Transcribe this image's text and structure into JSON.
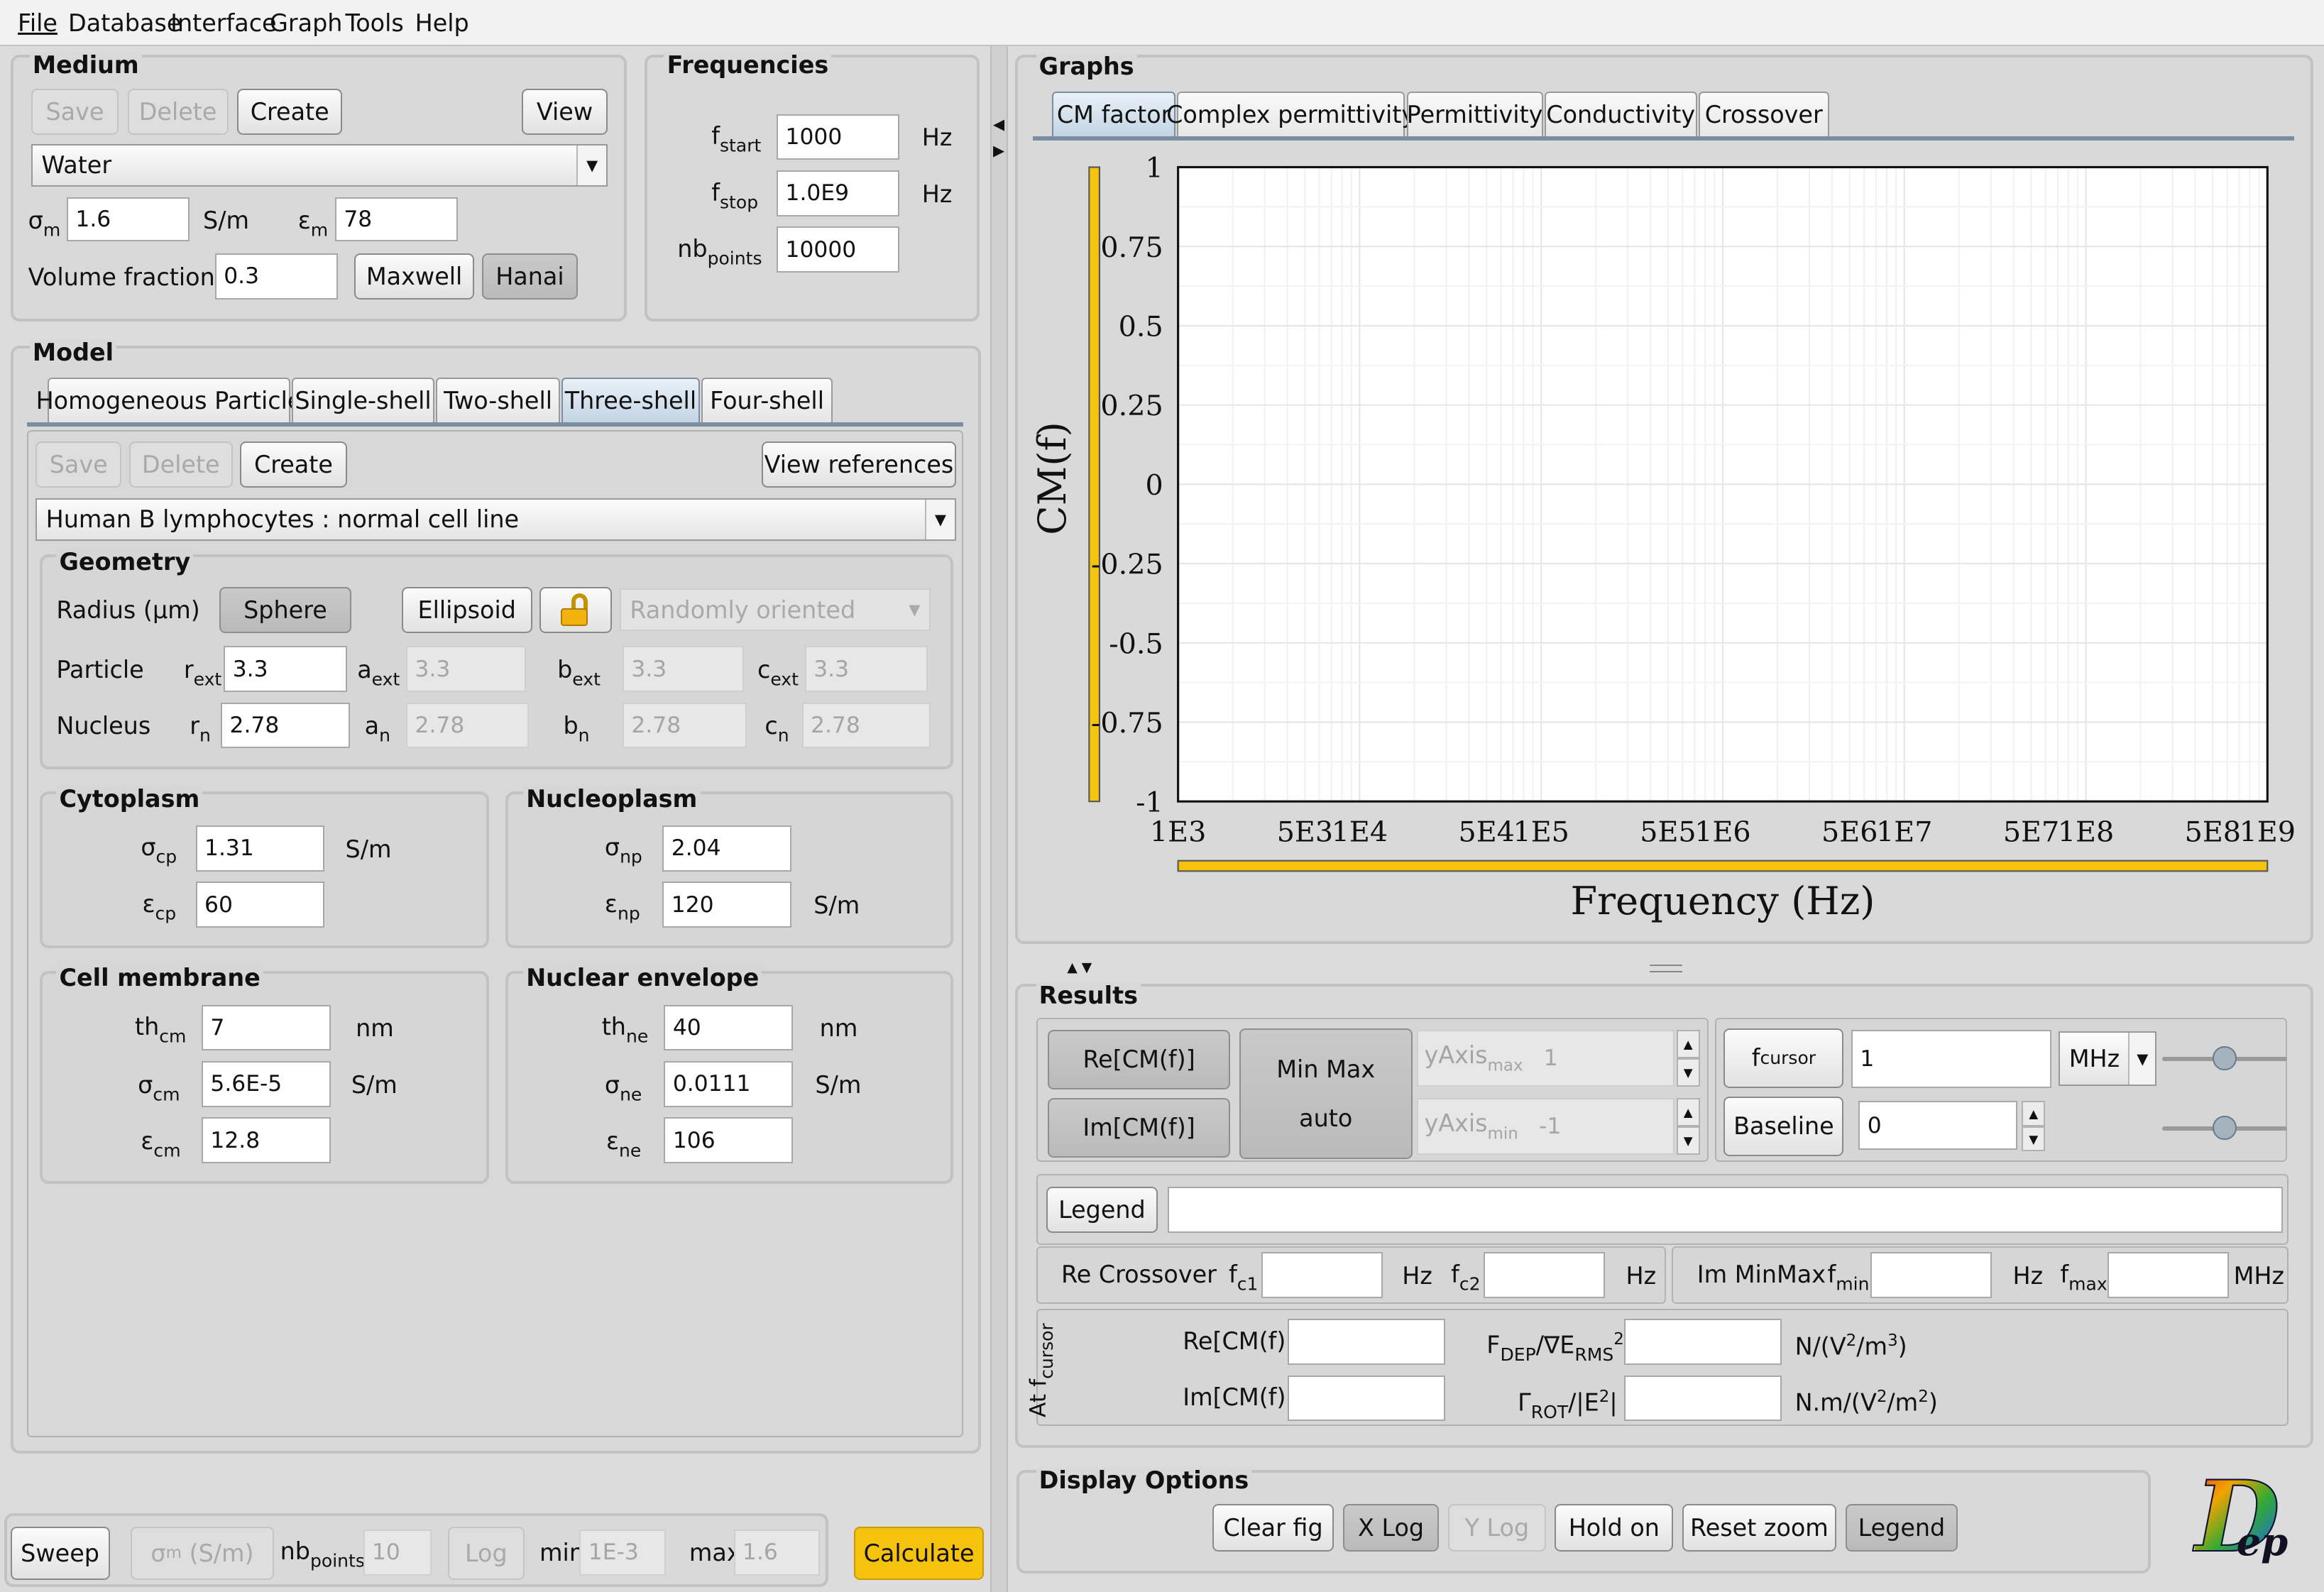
{
  "menu": [
    "File",
    "Database",
    "Interface",
    "Graph",
    "Tools",
    "Help"
  ],
  "medium": {
    "title": "Medium",
    "save": "Save",
    "delete": "Delete",
    "create": "Create",
    "view": "View",
    "selected": "Water",
    "sigma_label": "σ",
    "sigma_sub": "m",
    "sigma_value": "1.6",
    "sigma_unit": "S/m",
    "eps_label": "ε",
    "eps_sub": "m",
    "eps_value": "78",
    "vf_label": "Volume fraction Φ",
    "vf_value": "0.3",
    "maxwell": "Maxwell",
    "hanai": "Hanai"
  },
  "frequencies": {
    "title": "Frequencies",
    "fstart_sub": "start",
    "fstart_value": "1000",
    "fstop_sub": "stop",
    "fstop_value": "1.0E9",
    "nb_sub": "points",
    "nb_value": "10000",
    "unit": "Hz",
    "f": "f",
    "nb": "nb"
  },
  "model": {
    "title": "Model",
    "tabs": [
      "Homogeneous Particle",
      "Single-shell",
      "Two-shell",
      "Three-shell",
      "Four-shell"
    ],
    "save": "Save",
    "delete": "Delete",
    "create": "Create",
    "view_refs": "View references",
    "selected": "Human B lymphocytes : normal cell line",
    "geometry": {
      "title": "Geometry",
      "radius_label": "Radius (µm)",
      "sphere": "Sphere",
      "ellipsoid": "Ellipsoid",
      "orientation": "Randomly oriented",
      "particle": "Particle",
      "nucleus": "Nucleus",
      "r_ext": "3.3",
      "a_ext": "3.3",
      "b_ext": "3.3",
      "c_ext": "3.3",
      "r_n": "2.78",
      "a_n": "2.78",
      "b_n": "2.78",
      "c_n": "2.78",
      "sub_ext": "ext",
      "sub_n": "n"
    },
    "cytoplasm": {
      "title": "Cytoplasm",
      "sigma": "1.31",
      "sigma_unit": "S/m",
      "eps": "60",
      "sub": "cp"
    },
    "nucleoplasm": {
      "title": "Nucleoplasm",
      "sigma": "2.04",
      "eps": "120",
      "eps_unit": "S/m",
      "sub": "np"
    },
    "membrane": {
      "title": "Cell membrane",
      "th": "7",
      "th_unit": "nm",
      "sigma": "5.6E-5",
      "sigma_unit": "S/m",
      "eps": "12.8",
      "sub": "cm"
    },
    "envelope": {
      "title": "Nuclear envelope",
      "th": "40",
      "th_unit": "nm",
      "sigma": "0.0111",
      "sigma_unit": "S/m",
      "eps": "106",
      "sub": "ne"
    }
  },
  "sweep": {
    "sweep": "Sweep",
    "sigma": "σ",
    "sigma_sub": "m",
    "sigma_unit": "(S/m)",
    "nb": "nb",
    "nb_sub": "points",
    "nb_value": "10",
    "log": "Log",
    "min_label": "min",
    "min_value": "1E-3",
    "max_label": "max",
    "max_value": "1.6",
    "calculate": "Calculate"
  },
  "graphs": {
    "title": "Graphs",
    "tabs": [
      "CM factor",
      "Complex permittivity",
      "Permittivity",
      "Conductivity",
      "Crossover"
    ]
  },
  "chart_data": {
    "type": "line",
    "title": "",
    "xlabel": "Frequency (Hz)",
    "ylabel": "CM(f)",
    "xscale": "log",
    "xlim": [
      1000,
      1000000000
    ],
    "ylim": [
      -1,
      1
    ],
    "yticks": [
      "1",
      "0.75",
      "0.5",
      "0.25",
      "0",
      "-0.25",
      "-0.5",
      "-0.75",
      "-1"
    ],
    "xticks": [
      "1E3",
      "5E3",
      "1E4",
      "5E4",
      "1E5",
      "5E5",
      "1E6",
      "5E6",
      "1E7",
      "5E7",
      "1E8",
      "5E8",
      "1E9"
    ],
    "series": [],
    "grid": true,
    "accent": "#f5c20d"
  },
  "results": {
    "title": "Results",
    "re": "Re[CM(f)]",
    "im": "Im[CM(f)]",
    "minmax": "Min Max",
    "auto": "auto",
    "yaxis": "yAxis",
    "max_sub": "max",
    "min_sub": "min",
    "ymax": "1",
    "ymin": "-1",
    "fcursor": "f",
    "fcursor_sub": "cursor",
    "fcursor_value": "1",
    "unit": "MHz",
    "baseline": "Baseline",
    "baseline_value": "0",
    "legend": "Legend",
    "legend_value": "",
    "re_crossover": "Re Crossover",
    "fc1_sub": "c1",
    "fc2_sub": "c2",
    "hz": "Hz",
    "im_minmax": "Im MinMax",
    "fmin_sub": "min",
    "fmax_sub": "max",
    "mhz": "MHz",
    "at_fcursor": "At f",
    "re_label": "Re[CM(f)]",
    "im_label": "Im[CM(f)]",
    "fdep": "F",
    "fdep_sub": "DEP",
    "fdep_mid": "/∇E",
    "rms_sub": "RMS",
    "sq": "2",
    "fdep_unit": "N/(V",
    "fdep_unit2": "/m",
    "fdep_unit3": ")",
    "grot": "Γ",
    "grot_sub": "ROT",
    "grot_mid": "/|E",
    "grot_end": "|",
    "grot_unit": "N.m/(V",
    "grot_unit2": "/m",
    "grot_unit3": ")",
    "two": "2",
    "three": "3"
  },
  "display": {
    "title": "Display Options",
    "clear": "Clear fig",
    "xlog": "X Log",
    "ylog": "Y Log",
    "hold": "Hold on",
    "reset": "Reset zoom",
    "legend": "Legend"
  },
  "logo": {
    "d": "D",
    "ep": "ep"
  }
}
